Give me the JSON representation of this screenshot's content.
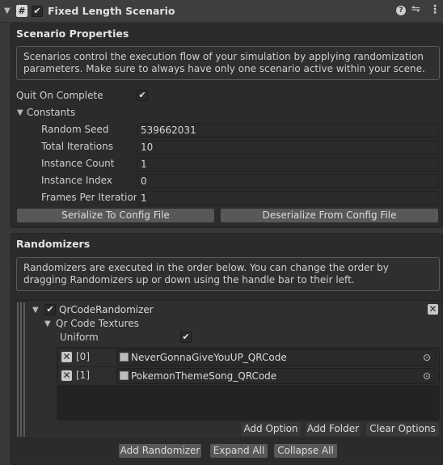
{
  "header": {
    "title": "Fixed Length Scenario",
    "enabled": "✔",
    "hash_glyph": "#",
    "help_glyph": "?",
    "presets_glyph": "⇋",
    "menu_glyph": "⋮"
  },
  "scenario": {
    "title": "Scenario Properties",
    "help": "Scenarios control the execution flow of your simulation by applying randomization parameters. Make sure to always have only one scenario active within your scene.",
    "quit_label": "Quit On Complete",
    "quit_value": "✔",
    "constants_label": "Constants",
    "fields": [
      {
        "label": "Random Seed",
        "value": "539662031"
      },
      {
        "label": "Total Iterations",
        "value": "10"
      },
      {
        "label": "Instance Count",
        "value": "1"
      },
      {
        "label": "Instance Index",
        "value": "0"
      },
      {
        "label": "Frames Per Iteration",
        "value": "1"
      }
    ],
    "serialize_label": "Serialize To Config File",
    "deserialize_label": "Deserialize From Config File"
  },
  "randomizers": {
    "title": "Randomizers",
    "help": "Randomizers are executed in the order below. You can change the order by dragging Randomizers up or down using the handle bar to their left.",
    "item": {
      "name": "QrCodeRandomizer",
      "enabled": "✔",
      "textures_label": "Qr Code Textures",
      "uniform_label": "Uniform",
      "uniform_value": "✔",
      "options": [
        {
          "index": "[0]",
          "value": "NeverGonnaGiveYouUP_QRCode"
        },
        {
          "index": "[1]",
          "value": "PokemonThemeSong_QRCode"
        }
      ],
      "add_option": "Add Option",
      "add_folder": "Add Folder",
      "clear_options": "Clear Options"
    },
    "add_randomizer": "Add Randomizer",
    "expand_all": "Expand All",
    "collapse_all": "Collapse All"
  }
}
